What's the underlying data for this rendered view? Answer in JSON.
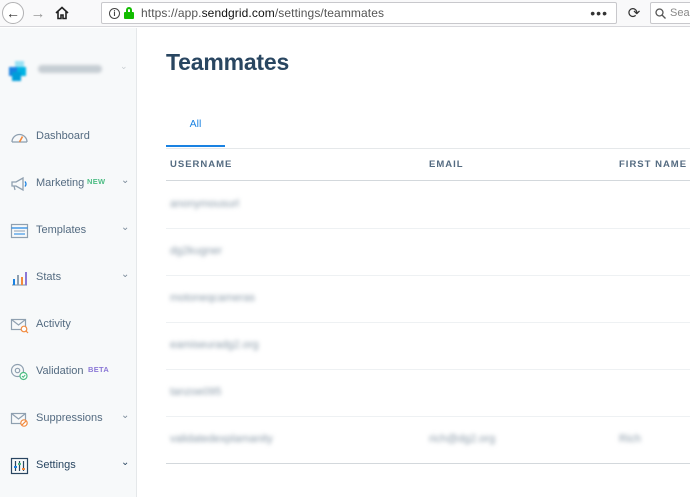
{
  "browser": {
    "url_prefix": "https://app.",
    "url_domain": "sendgrid.com",
    "url_path": "/settings/teammates",
    "page_actions": "•••",
    "search_placeholder": "Sea"
  },
  "sidebar": {
    "account_name": "fermasergi",
    "items": [
      {
        "label": "Dashboard",
        "icon": "dashboard-icon",
        "chevron": false
      },
      {
        "label": "Marketing",
        "icon": "megaphone-icon",
        "chevron": true,
        "tag": "NEW",
        "tag_color": "#4dbd84"
      },
      {
        "label": "Templates",
        "icon": "templates-icon",
        "chevron": true
      },
      {
        "label": "Stats",
        "icon": "stats-icon",
        "chevron": true
      },
      {
        "label": "Activity",
        "icon": "activity-icon",
        "chevron": false
      },
      {
        "label": "Validation",
        "icon": "validation-icon",
        "chevron": false,
        "tag": "BETA",
        "tag_color": "#8b78d6"
      },
      {
        "label": "Suppressions",
        "icon": "suppressions-icon",
        "chevron": true
      },
      {
        "label": "Settings",
        "icon": "settings-icon",
        "chevron": true,
        "active": true
      }
    ]
  },
  "main": {
    "title": "Teammates",
    "tabs": [
      {
        "label": "All",
        "active": true
      }
    ],
    "columns": [
      "USERNAME",
      "EMAIL",
      "FIRST NAME"
    ],
    "rows": [
      [
        "anonymousurl",
        "",
        ""
      ],
      [
        "dg2kugner",
        "",
        ""
      ],
      [
        "motoneqcameras",
        "",
        ""
      ],
      [
        "eamiseuradg2.org",
        "",
        ""
      ],
      [
        "tanzoe095",
        "",
        ""
      ],
      [
        "validatedexplamanity",
        "rich@dg2.org",
        "Rich"
      ]
    ]
  },
  "colors": {
    "accent": "#1a82e2",
    "title": "#294661",
    "sidebar_text": "#546b81",
    "secure_lock": "#12bc00"
  }
}
